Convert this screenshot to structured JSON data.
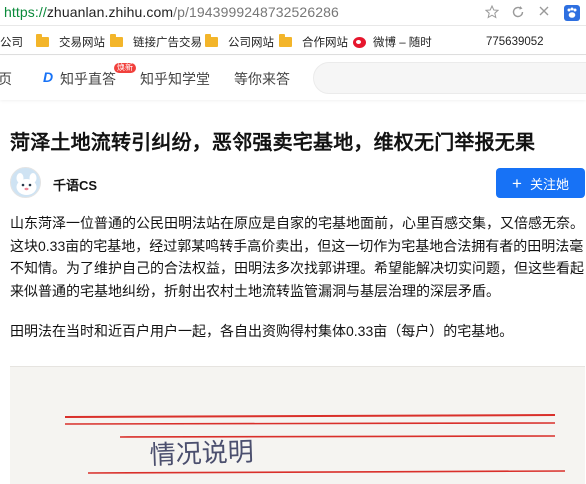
{
  "browser": {
    "url_protocol": "https://",
    "url_host": "zhuanlan.zhihu.com",
    "url_path": "/p/1943999248732526286",
    "toolbar_icons": [
      "star-icon",
      "refresh-icon",
      "close-icon",
      "paw-icon"
    ]
  },
  "bookmarks": {
    "items": [
      {
        "label": "公司",
        "icon": "none"
      },
      {
        "label": "交易网站",
        "icon": "folder-icon"
      },
      {
        "label": "链接广告交易",
        "icon": "folder-icon"
      },
      {
        "label": "公司网站",
        "icon": "folder-icon"
      },
      {
        "label": "合作网站",
        "icon": "folder-icon"
      },
      {
        "label": "微博 – 随时",
        "icon": "weibo-icon"
      },
      {
        "label": "775639052",
        "icon": "none"
      }
    ]
  },
  "nav": {
    "home": "页",
    "zhida_label": "知乎直答",
    "zhida_badge": "焕新",
    "zhixuetang": "知乎知学堂",
    "waiting": "等你来答"
  },
  "article": {
    "title": "菏泽土地流转引纠纷，恶邻强卖宅基地，维权无门举报无果",
    "author": "千语CS",
    "follow_label": "关注她",
    "paragraphs": [
      "山东菏泽一位普通的公民田明法站在原应是自家的宅基地面前，心里百感交集，又倍感无奈。这块0.33亩的宅基地，经过郭某鸣转手高价卖出，但这一切作为宅基地合法拥有者的田明法毫不知情。为了维护自己的合法权益，田明法多次找郭讲理。希望能解决切实问题，但这些看起来似普通的宅基地纠纷，折射出农村土地流转监管漏洞与基层治理的深层矛盾。",
      "田明法在当时和近百户用户一起，各自出资购得村集体0.33亩（每户）的宅基地。"
    ],
    "image_handwriting": "情况说明"
  },
  "colors": {
    "accent": "#1772f6",
    "badge": "#f1403c",
    "folder": "#f3b52a",
    "ruled_line": "#d9302b"
  }
}
